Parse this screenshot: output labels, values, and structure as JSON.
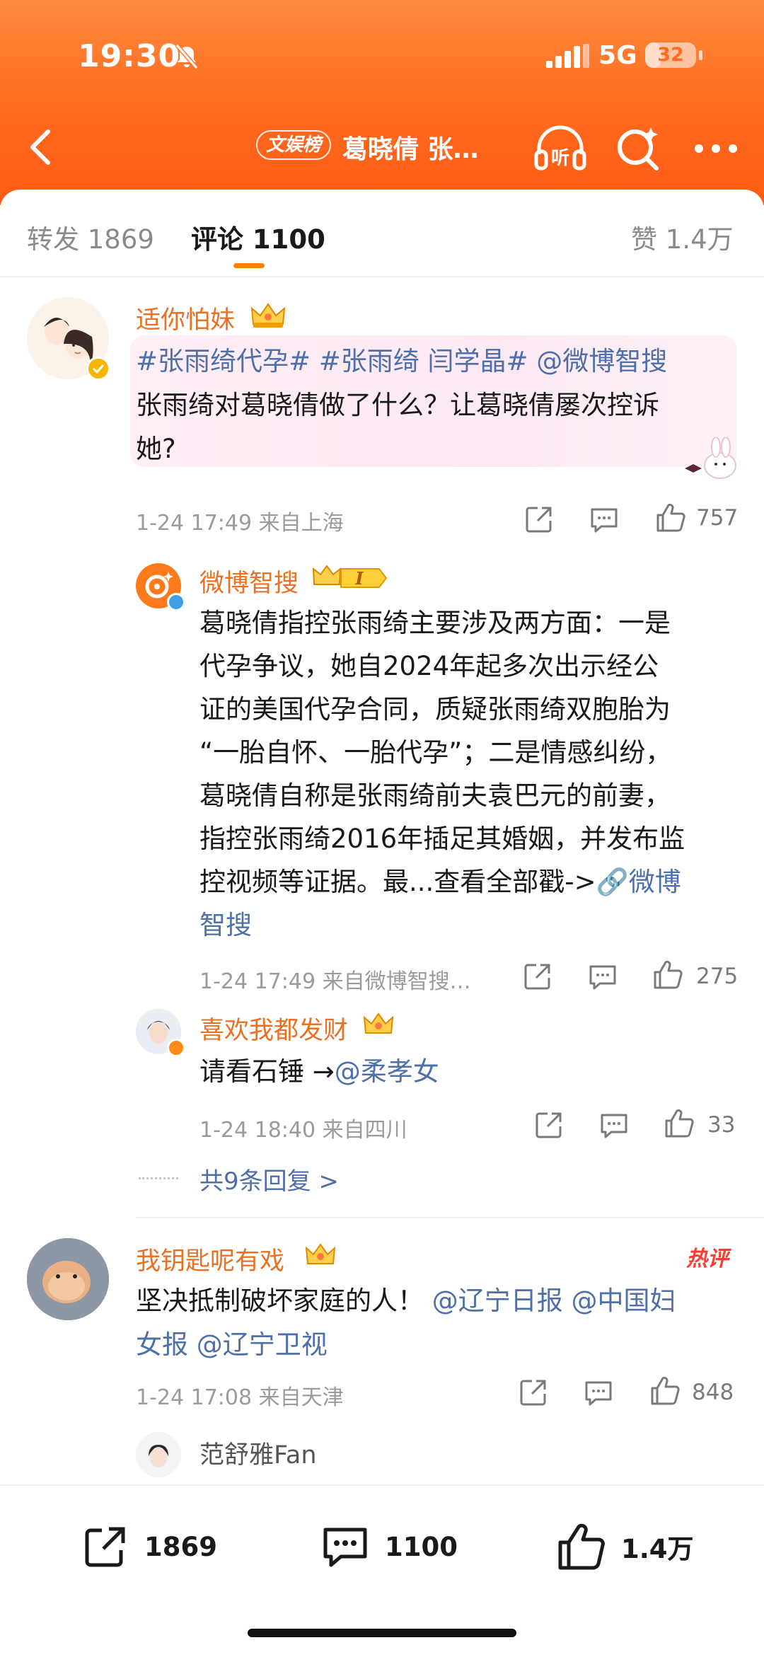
{
  "status_bar": {
    "time": "19:30",
    "network": "5G",
    "battery": "32"
  },
  "nav": {
    "rank_badge": "文娱榜",
    "title": "葛晓倩 张…"
  },
  "tabs": {
    "repost": "转发 1869",
    "comments": "评论 1100",
    "likes": "赞 1.4万"
  },
  "comments": [
    {
      "username": "适你怕妹",
      "text_links": "#张雨绮代孕# #张雨绮 闫学晶# @微博智搜",
      "text_line2": "张雨绮对葛晓倩做了什么？让葛晓倩屡次控诉",
      "text_line3": "她?",
      "meta": "1-24 17:49 来自上海",
      "likes": "757",
      "replies": [
        {
          "username": "微博智搜",
          "level": "I",
          "lines": [
            "葛晓倩指控张雨绮主要涉及两方面：一是",
            "代孕争议，她自2024年起多次出示经公",
            "证的美国代孕合同，质疑张雨绮双胞胎为",
            "“一胎自怀、一胎代孕”；二是情感纠纷，",
            "葛晓倩自称是张雨绮前夫袁巴元的前妻，",
            "指控张雨绮2016年插足其婚姻，并发布监"
          ],
          "line7_text": "控视频等证据。最...查看全部戳->",
          "line7_link": "微博",
          "line8_link": "智搜",
          "meta": "1-24 17:49 来自微博智搜…",
          "likes": "275"
        },
        {
          "username": "喜欢我都发财",
          "text": "请看石锤 →",
          "text_link": "@柔孝女",
          "meta": "1-24 18:40 来自四川",
          "likes": "33"
        }
      ],
      "more_replies": "共9条回复 >"
    },
    {
      "username": "我钥匙呢有戏",
      "hot_tag": "热评",
      "text_line1": "坚决抵制破坏家庭的人！",
      "text_line1_link": "@辽宁日报 @中国妇",
      "text_line2_link": "女报 @辽宁卫视",
      "meta": "1-24 17:08 来自天津",
      "likes": "848",
      "reply_preview_user": "范舒雅Fan"
    }
  ],
  "bottom_bar": {
    "reposts": "1869",
    "comments": "1100",
    "likes": "1.4万"
  },
  "colors": {
    "brand_orange": "#ff6a1f",
    "username": "#ea7124",
    "link": "#4e6fa8",
    "hot": "#ff3d2e"
  }
}
